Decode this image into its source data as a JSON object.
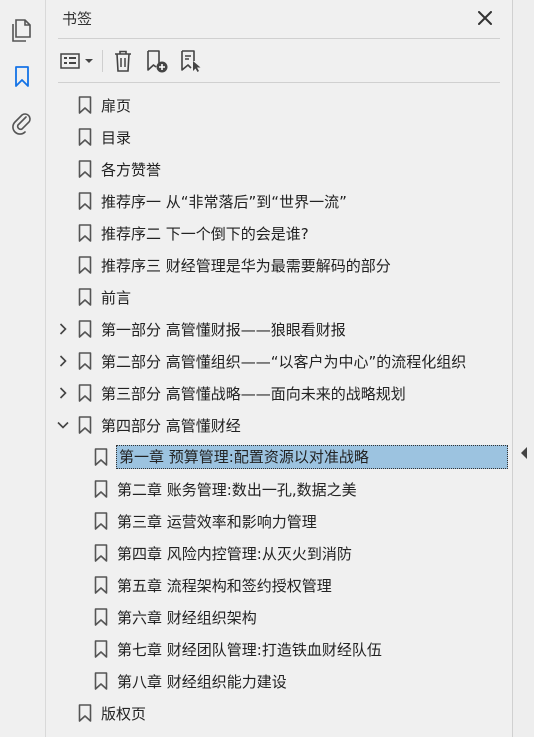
{
  "panel": {
    "title": "书签",
    "close_icon": "close-icon"
  },
  "left_rail": {
    "items": [
      {
        "name": "pages-icon"
      },
      {
        "name": "bookmark-icon",
        "active": true,
        "color": "#1473e6"
      },
      {
        "name": "attachment-icon"
      }
    ]
  },
  "toolbar": {
    "items": [
      "options-menu-icon",
      "delete-icon",
      "new-bookmark-icon",
      "bookmark-from-structure-icon"
    ]
  },
  "bookmarks": [
    {
      "label": "扉页"
    },
    {
      "label": "目录"
    },
    {
      "label": "各方赞誉"
    },
    {
      "label": "推荐序一 从“非常落后”到“世界一流”"
    },
    {
      "label": "推荐序二 下一个倒下的会是谁?"
    },
    {
      "label": "推荐序三 财经管理是华为最需要解码的部分"
    },
    {
      "label": "前言"
    },
    {
      "label": "第一部分 高管懂财报——狼眼看财报"
    },
    {
      "label": "第二部分 高管懂组织——“以客户为中心”的流程化组织"
    },
    {
      "label": "第三部分 高管懂战略——面向未来的战略规划"
    },
    {
      "label": "第四部分 高管懂财经"
    },
    {
      "label": "第一章 预算管理:配置资源以对准战略"
    },
    {
      "label": "第二章 账务管理:数出一孔,数据之美"
    },
    {
      "label": "第三章 运营效率和影响力管理"
    },
    {
      "label": "第四章 风险内控管理:从灭火到消防"
    },
    {
      "label": "第五章 流程架构和签约授权管理"
    },
    {
      "label": "第六章 财经组织架构"
    },
    {
      "label": "第七章 财经团队管理:打造铁血财经队伍"
    },
    {
      "label": "第八章 财经组织能力建设"
    },
    {
      "label": "版权页"
    }
  ],
  "selection_color": "#9cc3e0"
}
